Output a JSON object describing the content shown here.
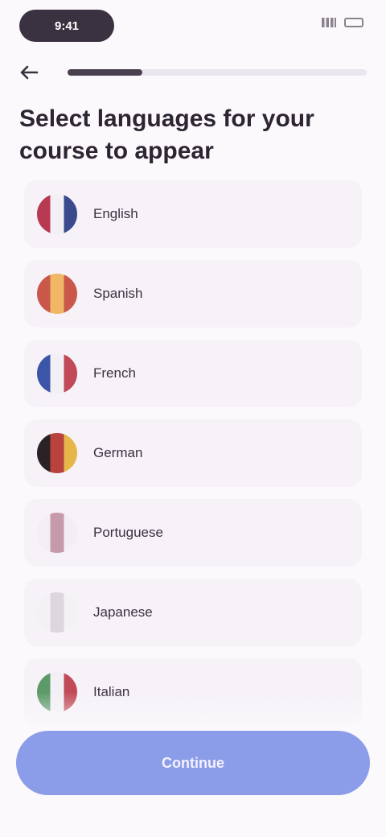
{
  "status_bar": {
    "time": "9:41"
  },
  "header": {
    "progress_fraction": 0.25,
    "title": "Select languages for your course to appear"
  },
  "languages": [
    {
      "label": "English",
      "flag": "gb-flag-icon",
      "colors": [
        "#b83a52",
        "#f2f0f5",
        "#3b4a8c"
      ]
    },
    {
      "label": "Spanish",
      "flag": "es-flag-icon",
      "colors": [
        "#c9584a",
        "#f0b866",
        "#c9584a"
      ]
    },
    {
      "label": "French",
      "flag": "fr-flag-icon",
      "colors": [
        "#3b55a8",
        "#f2f0f5",
        "#c24a58"
      ]
    },
    {
      "label": "German",
      "flag": "de-flag-icon",
      "colors": [
        "#2b2226",
        "#b8423c",
        "#e7b64a"
      ]
    },
    {
      "label": "Portuguese",
      "flag": "pt-flag-icon",
      "colors": [
        "#f2eef3",
        "#c79aab",
        "#f2eef3"
      ]
    },
    {
      "label": "Japanese",
      "flag": "jp-flag-icon",
      "colors": [
        "#f4f1f5",
        "#dcd6de",
        "#f4f1f5"
      ]
    },
    {
      "label": "Italian",
      "flag": "it-flag-icon",
      "colors": [
        "#5d9a6a",
        "#f2f0f5",
        "#c24a58"
      ]
    }
  ],
  "footer": {
    "continue_label": "Continue"
  },
  "colors": {
    "background": "#fcf9fd",
    "card": "#f6f2f8",
    "accent": "#8b9de8",
    "progress": "#4a4150"
  }
}
